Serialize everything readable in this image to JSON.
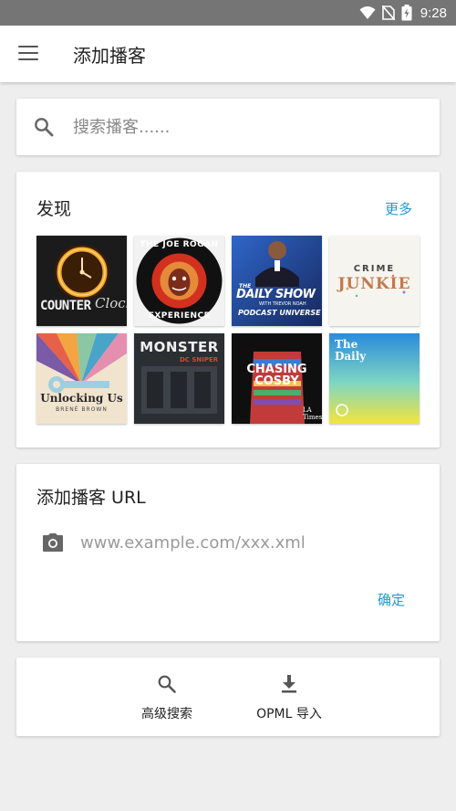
{
  "status_bar": {
    "time": "9:28"
  },
  "app_bar": {
    "title": "添加播客"
  },
  "search": {
    "placeholder": "搜索播客......"
  },
  "discover": {
    "title": "发现",
    "more_label": "更多",
    "podcasts": [
      {
        "cover_text": [
          "COUNTER",
          "Clock"
        ]
      },
      {
        "cover_text": [
          "THE JOE ROGAN",
          "EXPERIENCE"
        ]
      },
      {
        "cover_text": [
          "THE",
          "DAILY SHOW",
          "WITH TREVOR NOAH",
          "PODCAST UNIVERSE"
        ]
      },
      {
        "cover_text": [
          "CRIME",
          "JUNKIE"
        ]
      },
      {
        "cover_text": [
          "Unlocking Us",
          "BRENÉ BROWN"
        ]
      },
      {
        "cover_text": [
          "MONSTER",
          "DC SNIPER"
        ]
      },
      {
        "cover_text": [
          "CHASING",
          "COSBY",
          "LA Times"
        ]
      },
      {
        "cover_text": [
          "The",
          "Daily"
        ]
      }
    ]
  },
  "add_url": {
    "title": "添加播客 URL",
    "placeholder": "www.example.com/xxx.xml",
    "confirm_label": "确定"
  },
  "actions": {
    "advanced_search_label": "高级搜索",
    "opml_import_label": "OPML 导入"
  },
  "colors": {
    "accent": "#1e9ad6",
    "status_bar": "#757575",
    "background": "#eeeeee"
  }
}
